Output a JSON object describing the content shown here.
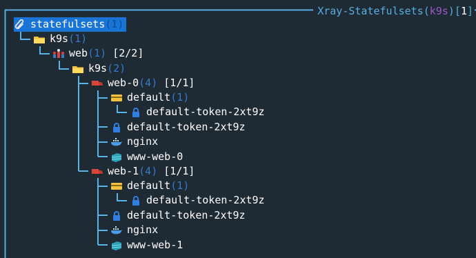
{
  "title": {
    "prefix": "Xray-Statefulsets(",
    "namespace": "k9s",
    "suffix": ")",
    "count_open": "[",
    "count": "1",
    "count_close": "]"
  },
  "colors": {
    "background": "#1f2b34",
    "border": "#58aee0",
    "title_text": "#58aee0",
    "namespace": "#9b59c8",
    "count_text": "#3a78c9",
    "highlight": "#1a74d6",
    "tree_lines": "#5ab4e6"
  },
  "tree": {
    "root": {
      "icon": "paperclip-icon",
      "label": "statefulsets",
      "count": "(1)"
    },
    "ns1": {
      "icon": "folder-icon",
      "label": "k9s",
      "count": "(1)"
    },
    "sts": {
      "icon": "statefulset-icon",
      "label": "web",
      "count": "(1)",
      "ready": "[2/2]"
    },
    "ns2": {
      "icon": "folder-icon",
      "label": "k9s",
      "count": "(2)"
    },
    "pods": [
      {
        "icon": "pod-truck-icon",
        "label": "web-0",
        "count": "(4)",
        "ready": "[1/1]",
        "sa": {
          "icon": "service-account-card-icon",
          "label": "default",
          "count": "(1)"
        },
        "sa_secret": {
          "icon": "lock-icon",
          "label": "default-token-2xt9z"
        },
        "secret": {
          "icon": "lock-icon",
          "label": "default-token-2xt9z"
        },
        "container": {
          "icon": "docker-whale-icon",
          "label": "nginx"
        },
        "pvc": {
          "icon": "volume-icon",
          "label": "www-web-0"
        }
      },
      {
        "icon": "pod-truck-icon",
        "label": "web-1",
        "count": "(4)",
        "ready": "[1/1]",
        "sa": {
          "icon": "service-account-card-icon",
          "label": "default",
          "count": "(1)"
        },
        "sa_secret": {
          "icon": "lock-icon",
          "label": "default-token-2xt9z"
        },
        "secret": {
          "icon": "lock-icon",
          "label": "default-token-2xt9z"
        },
        "container": {
          "icon": "docker-whale-icon",
          "label": "nginx"
        },
        "pvc": {
          "icon": "volume-icon",
          "label": "www-web-1"
        }
      }
    ]
  }
}
